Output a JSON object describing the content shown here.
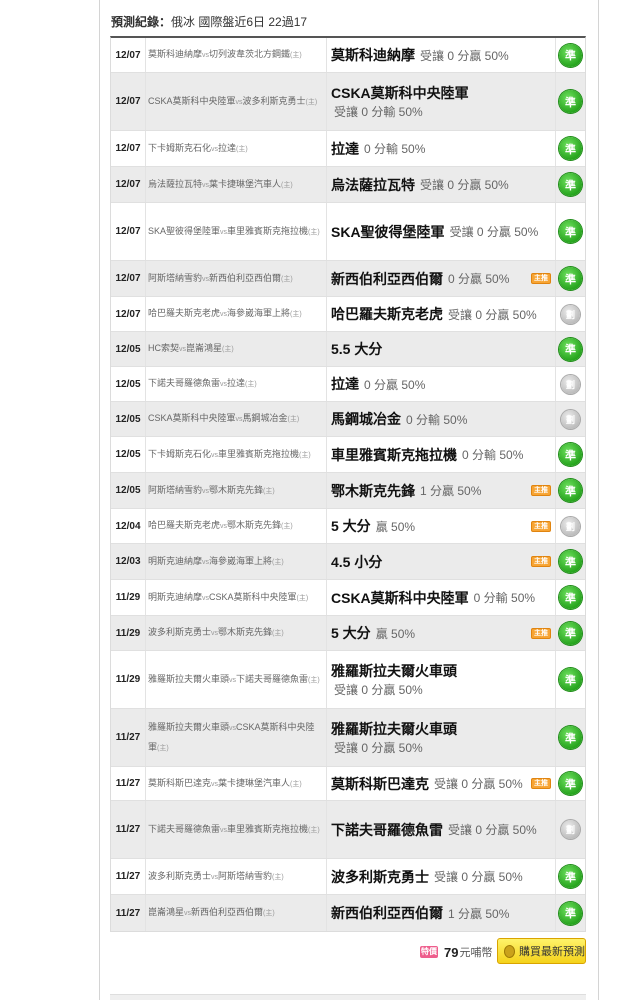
{
  "header": {
    "label": "預測紀錄：",
    "summary": "俄冰 國際盤近6日 22過17"
  },
  "rows": [
    {
      "date": "12/07",
      "home": "莫斯科迪納摩",
      "away": "切列波韋茨北方鋼鐵",
      "vs": "vs",
      "home_mark": "(主)",
      "pick": "莫斯科迪納摩",
      "odds": "受讓 0 分贏 50%",
      "result": "準",
      "hit": true,
      "gray": false,
      "tag": false,
      "two_line": false
    },
    {
      "date": "12/07",
      "home": "CSKA莫斯科中央陸軍",
      "away": "波多利斯克勇士",
      "vs": "vs",
      "home_mark": "(主)",
      "pick": "CSKA莫斯科中央陸軍",
      "odds": "受讓 0 分輸 50%",
      "result": "準",
      "hit": true,
      "gray": true,
      "tag": false,
      "two_line": true
    },
    {
      "date": "12/07",
      "home": "下卡姆斯克石化",
      "away": "拉達",
      "vs": "vs",
      "home_mark": "(主)",
      "pick": "拉達",
      "odds": "0 分輸 50%",
      "result": "準",
      "hit": true,
      "gray": false,
      "tag": false,
      "two_line": false
    },
    {
      "date": "12/07",
      "home": "烏法薩拉瓦特",
      "away": "葉卡捷琳堡汽車人",
      "vs": "vs",
      "home_mark": "(主)",
      "pick": "烏法薩拉瓦特",
      "odds": "受讓 0 分贏 50%",
      "result": "準",
      "hit": true,
      "gray": true,
      "tag": false,
      "two_line": false
    },
    {
      "date": "12/07",
      "home": "SKA聖彼得堡陸軍",
      "away": "車里雅賓斯克拖拉機",
      "vs": "vs",
      "home_mark": "(主)",
      "pick": "SKA聖彼得堡陸軍",
      "odds": "受讓 0 分贏 50%",
      "result": "準",
      "hit": true,
      "gray": false,
      "tag": false,
      "two_line": false
    },
    {
      "date": "12/07",
      "home": "阿斯塔納雪豹",
      "away": "新西伯利亞西伯爾",
      "vs": "vs",
      "home_mark": "(主)",
      "pick": "新西伯利亞西伯爾",
      "odds": "0 分贏 50%",
      "result": "準",
      "hit": true,
      "gray": true,
      "tag": true,
      "tag_text": "主推",
      "two_line": false
    },
    {
      "date": "12/07",
      "home": "哈巴羅夫斯克老虎",
      "away": "海參崴海軍上將",
      "vs": "vs",
      "home_mark": "(主)",
      "pick": "哈巴羅夫斯克老虎",
      "odds": "受讓 0 分贏 50%",
      "result": "劃",
      "hit": false,
      "gray": false,
      "tag": false,
      "two_line": false
    },
    {
      "date": "12/05",
      "home": "HC索契",
      "away": "崑崙鴻星",
      "vs": "vs",
      "home_mark": "(主)",
      "pick": "5.5 大分",
      "odds": "",
      "result": "準",
      "hit": true,
      "gray": true,
      "tag": false,
      "two_line": false
    },
    {
      "date": "12/05",
      "home": "下諾夫哥羅德魚雷",
      "away": "拉達",
      "vs": "vs",
      "home_mark": "(主)",
      "pick": "拉達",
      "odds": "0 分贏 50%",
      "result": "劃",
      "hit": false,
      "gray": false,
      "tag": false,
      "two_line": false
    },
    {
      "date": "12/05",
      "home": "CSKA莫斯科中央陸軍",
      "away": "馬鋼城冶金",
      "vs": "vs",
      "home_mark": "(主)",
      "pick": "馬鋼城冶金",
      "odds": "0 分輸 50%",
      "result": "劃",
      "hit": false,
      "gray": true,
      "tag": false,
      "two_line": false
    },
    {
      "date": "12/05",
      "home": "下卡姆斯克石化",
      "away": "車里雅賓斯克拖拉機",
      "vs": "vs",
      "home_mark": "(主)",
      "pick": "車里雅賓斯克拖拉機",
      "odds": "0 分輸 50%",
      "result": "準",
      "hit": true,
      "gray": false,
      "tag": false,
      "two_line": false
    },
    {
      "date": "12/05",
      "home": "阿斯塔納雪豹",
      "away": "鄂木斯克先鋒",
      "vs": "vs",
      "home_mark": "(主)",
      "pick": "鄂木斯克先鋒",
      "odds": "1 分贏 50%",
      "result": "準",
      "hit": true,
      "gray": true,
      "tag": true,
      "tag_text": "主推",
      "two_line": false
    },
    {
      "date": "12/04",
      "home": "哈巴羅夫斯克老虎",
      "away": "鄂木斯克先鋒",
      "vs": "vs",
      "home_mark": "(主)",
      "pick": "5 大分",
      "odds": "贏 50%",
      "result": "劃",
      "hit": false,
      "gray": false,
      "tag": true,
      "tag_text": "主推",
      "two_line": false
    },
    {
      "date": "12/03",
      "home": "明斯克迪納摩",
      "away": "海參崴海軍上將",
      "vs": "vs",
      "home_mark": "(主)",
      "pick": "4.5 小分",
      "odds": "",
      "result": "準",
      "hit": true,
      "gray": true,
      "tag": true,
      "tag_text": "主推",
      "two_line": false
    },
    {
      "date": "11/29",
      "home": "明斯克迪納摩",
      "away": "CSKA莫斯科中央陸軍",
      "vs": "vs",
      "home_mark": "(主)",
      "pick": "CSKA莫斯科中央陸軍",
      "odds": "0 分輸 50%",
      "result": "準",
      "hit": true,
      "gray": false,
      "tag": false,
      "two_line": false
    },
    {
      "date": "11/29",
      "home": "波多利斯克勇士",
      "away": "鄂木斯克先鋒",
      "vs": "vs",
      "home_mark": "(主)",
      "pick": "5 大分",
      "odds": "贏 50%",
      "result": "準",
      "hit": true,
      "gray": true,
      "tag": true,
      "tag_text": "主推",
      "two_line": false
    },
    {
      "date": "11/29",
      "home": "雅羅斯拉夫爾火車頭",
      "away": "下諾夫哥羅德魚雷",
      "vs": "vs",
      "home_mark": "(主)",
      "pick": "雅羅斯拉夫爾火車頭",
      "odds": "受讓 0 分贏 50%",
      "result": "準",
      "hit": true,
      "gray": false,
      "tag": false,
      "two_line": true
    },
    {
      "date": "11/27",
      "home": "雅羅斯拉夫爾火車頭",
      "away": "CSKA莫斯科中央陸軍",
      "vs": "vs",
      "home_mark": "(主)",
      "pick": "雅羅斯拉夫爾火車頭",
      "odds": "受讓 0 分贏 50%",
      "result": "準",
      "hit": true,
      "gray": true,
      "tag": false,
      "two_line": true
    },
    {
      "date": "11/27",
      "home": "莫斯科斯巴達克",
      "away": "葉卡捷琳堡汽車人",
      "vs": "vs",
      "home_mark": "(主)",
      "pick": "莫斯科斯巴達克",
      "odds": "受讓 0 分贏 50%",
      "result": "準",
      "hit": true,
      "gray": false,
      "tag": true,
      "tag_text": "主推",
      "two_line": false
    },
    {
      "date": "11/27",
      "home": "下諾夫哥羅德魚雷",
      "away": "車里雅賓斯克拖拉機",
      "vs": "vs",
      "home_mark": "(主)",
      "pick": "下諾夫哥羅德魚雷",
      "odds": "受讓 0 分贏 50%",
      "result": "劃",
      "hit": false,
      "gray": true,
      "tag": false,
      "two_line": false
    },
    {
      "date": "11/27",
      "home": "波多利斯克勇士",
      "away": "阿斯塔納雪豹",
      "vs": "vs",
      "home_mark": "(主)",
      "pick": "波多利斯克勇士",
      "odds": "受讓 0 分贏 50%",
      "result": "準",
      "hit": true,
      "gray": false,
      "tag": false,
      "two_line": false
    },
    {
      "date": "11/27",
      "home": "崑崙鴻星",
      "away": "新西伯利亞西伯爾",
      "vs": "vs",
      "home_mark": "(主)",
      "pick": "新西伯利亞西伯爾",
      "odds": "1 分贏 50%",
      "result": "準",
      "hit": true,
      "gray": true,
      "tag": false,
      "two_line": false
    }
  ],
  "footer": {
    "sale_tag": "特價",
    "price": "79",
    "price_unit": "元哺幣",
    "buy_label": "購買最新預測"
  },
  "colors": {
    "hit": "#27a51e",
    "miss": "#bdbdbd",
    "tag": "#f7a433",
    "button": "#f4d21b"
  }
}
